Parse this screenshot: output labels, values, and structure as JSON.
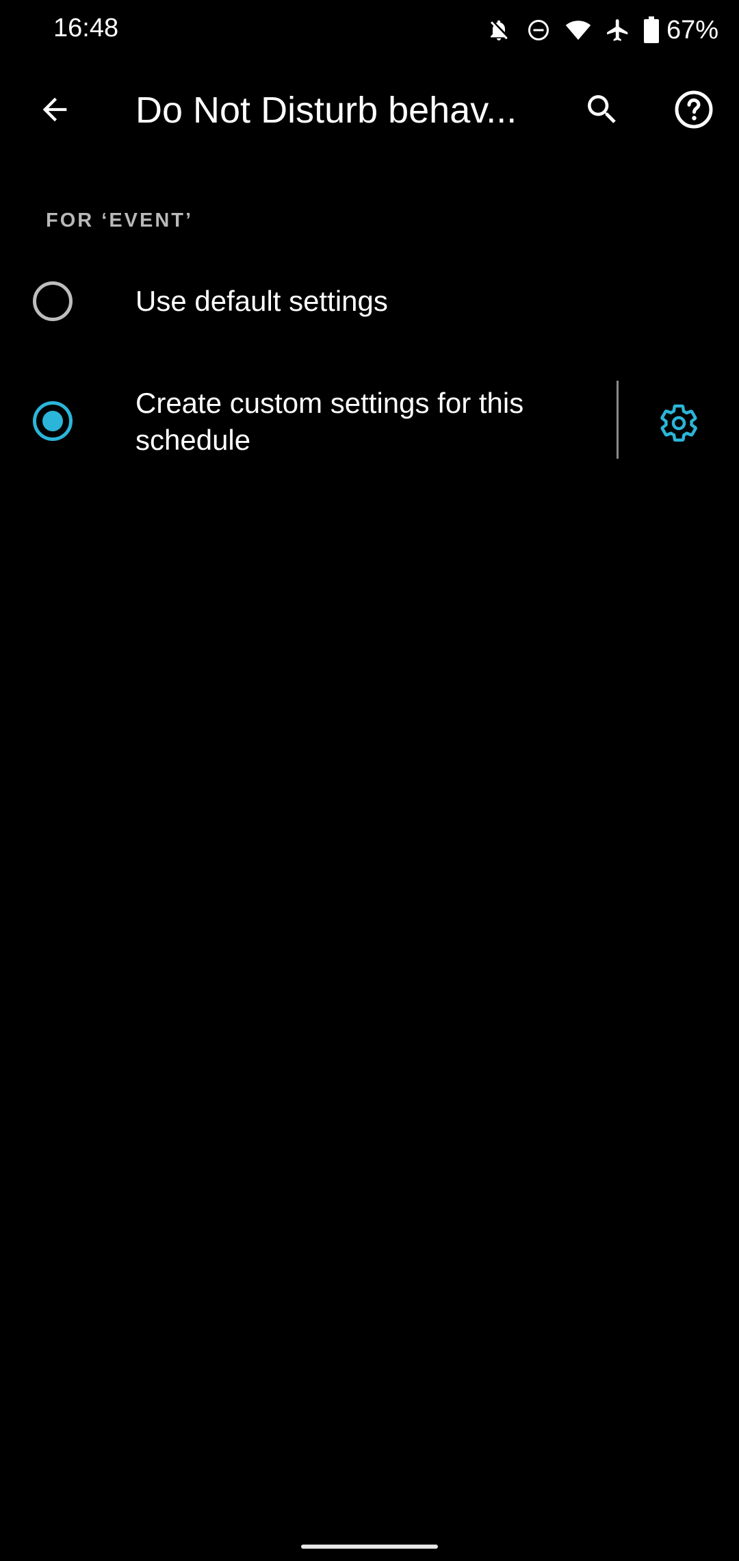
{
  "status_bar": {
    "time": "16:48",
    "battery": "67%",
    "icons": [
      "bell-off-icon",
      "dnd-icon",
      "wifi-icon",
      "airplane-icon",
      "battery-icon"
    ]
  },
  "app_bar": {
    "title": "Do Not Disturb behav...",
    "icons": [
      "back-arrow-icon",
      "search-icon",
      "help-icon"
    ]
  },
  "section": {
    "header": "FOR ‘EVENT’"
  },
  "options": [
    {
      "label": "Use default settings",
      "selected": false
    },
    {
      "label": "Create custom settings for this schedule",
      "selected": true,
      "settings_icon": "gear-icon"
    }
  ],
  "colors": {
    "accent": "#2bb5d9",
    "background": "#000000",
    "text": "#ffffff",
    "section_header": "#b9b9b9"
  }
}
